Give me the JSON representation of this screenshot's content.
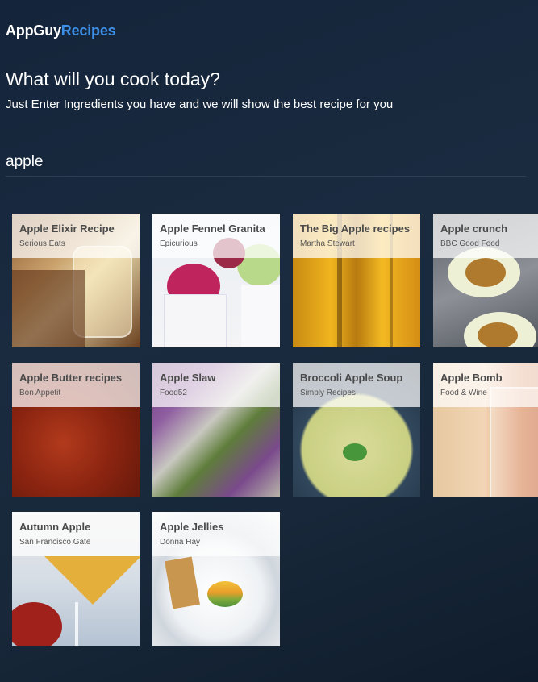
{
  "brand": {
    "main": "AppGuy",
    "accent": "Recipes"
  },
  "headline": "What will you cook today?",
  "subline": "Just Enter Ingredients you have and we will show the best recipe for you",
  "search": {
    "value": "apple"
  },
  "recipes": [
    {
      "title": "Apple Elixir Recipe",
      "source": "Serious Eats"
    },
    {
      "title": "Apple Fennel Granita",
      "source": "Epicurious"
    },
    {
      "title": "The Big Apple recipes",
      "source": "Martha Stewart"
    },
    {
      "title": "Apple crunch",
      "source": "BBC Good Food"
    },
    {
      "title": "Apple Butter recipes",
      "source": "Bon Appetit"
    },
    {
      "title": "Apple Slaw",
      "source": "Food52"
    },
    {
      "title": "Broccoli Apple Soup",
      "source": "Simply Recipes"
    },
    {
      "title": "Apple Bomb",
      "source": "Food & Wine"
    },
    {
      "title": "Autumn Apple",
      "source": "San Francisco Gate"
    },
    {
      "title": "Apple Jellies",
      "source": "Donna Hay"
    }
  ],
  "colors": {
    "accent": "#3c8fe6",
    "background": "#1a2b40"
  }
}
